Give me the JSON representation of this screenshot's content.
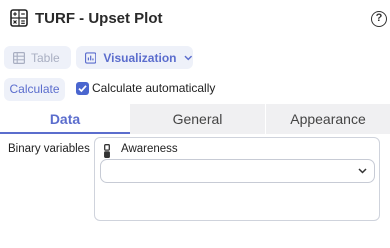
{
  "header": {
    "title": "TURF - Upset Plot",
    "icon": "calculator-icon",
    "help_icon": "help-circle-icon"
  },
  "view_switch": {
    "table_label": "Table",
    "visualization_label": "Visualization",
    "selected": "Visualization"
  },
  "controls": {
    "calculate_label": "Calculate",
    "auto_label": "Calculate automatically",
    "auto_checked": true
  },
  "tabs": [
    {
      "label": "Data",
      "active": true
    },
    {
      "label": "General",
      "active": false
    },
    {
      "label": "Appearance",
      "active": false
    }
  ],
  "data_panel": {
    "binary_label": "Binary variables",
    "variables": [
      "Awareness"
    ],
    "select_value": ""
  },
  "colors": {
    "accent": "#5b6dcd",
    "checkbox": "#4a66cf",
    "pill_bg": "#eef1f9",
    "tab_bar": "#f0f0f2"
  }
}
